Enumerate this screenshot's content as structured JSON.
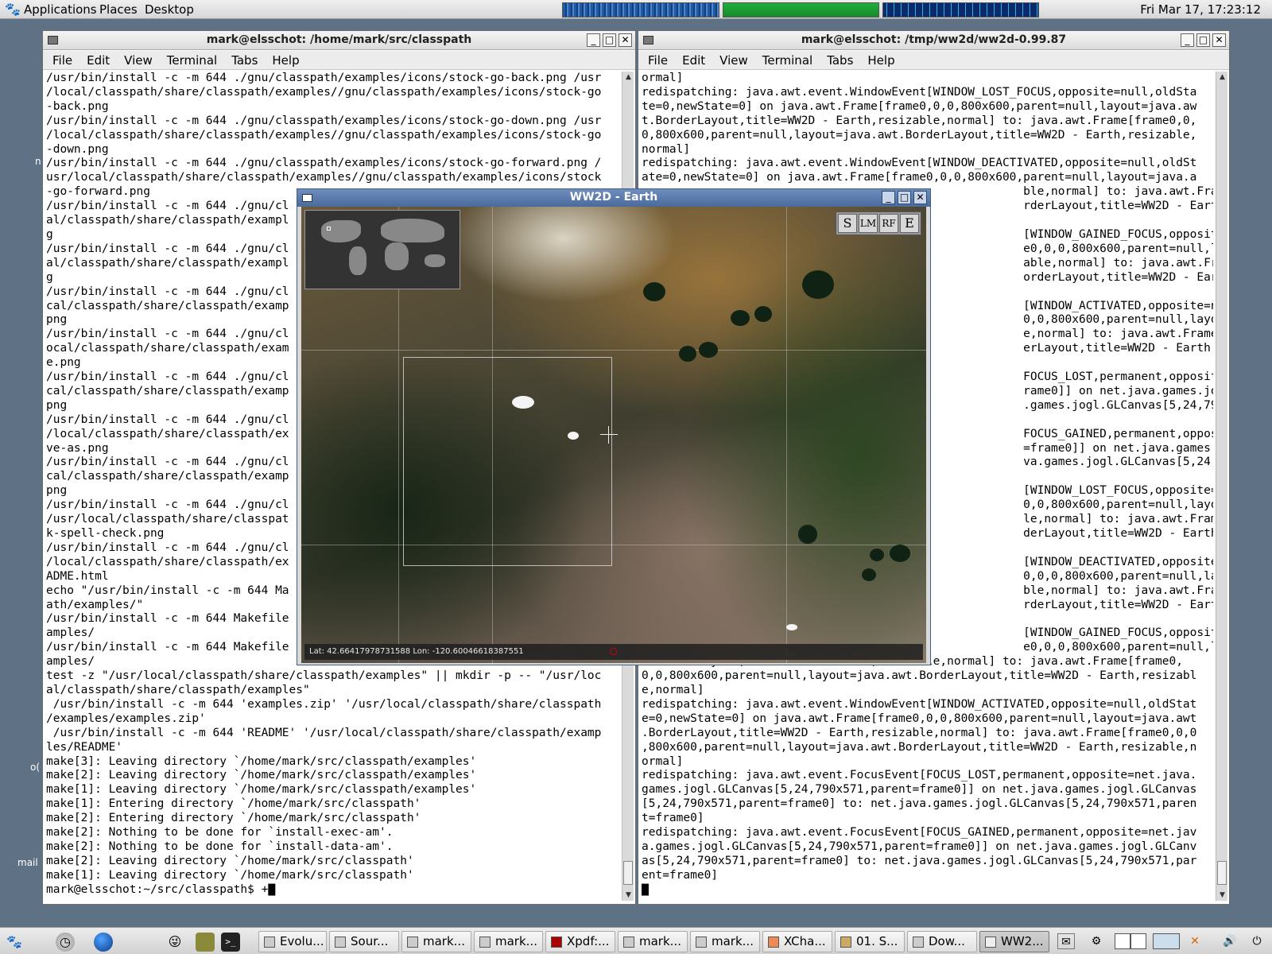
{
  "top_panel": {
    "menus": [
      "Applications",
      "Places",
      "Desktop"
    ],
    "clock": "Fri Mar 17, 17:23:12"
  },
  "desktop": {
    "labels": [
      "n",
      "o(",
      "mail"
    ]
  },
  "terminal_left": {
    "title": "mark@elsschot: /home/mark/src/classpath",
    "menu": [
      "File",
      "Edit",
      "View",
      "Terminal",
      "Tabs",
      "Help"
    ],
    "lines": [
      "/usr/bin/install -c -m 644 ./gnu/classpath/examples/icons/stock-go-back.png /usr",
      "/local/classpath/share/classpath/examples//gnu/classpath/examples/icons/stock-go",
      "-back.png",
      "/usr/bin/install -c -m 644 ./gnu/classpath/examples/icons/stock-go-down.png /usr",
      "/local/classpath/share/classpath/examples//gnu/classpath/examples/icons/stock-go",
      "-down.png",
      "/usr/bin/install -c -m 644 ./gnu/classpath/examples/icons/stock-go-forward.png /",
      "usr/local/classpath/share/classpath/examples//gnu/classpath/examples/icons/stock",
      "-go-forward.png",
      "/usr/bin/install -c -m 644 ./gnu/cl",
      "al/classpath/share/classpath/exampl",
      "g",
      "/usr/bin/install -c -m 644 ./gnu/cl",
      "al/classpath/share/classpath/exampl",
      "g",
      "/usr/bin/install -c -m 644 ./gnu/cl",
      "cal/classpath/share/classpath/examp",
      "png",
      "/usr/bin/install -c -m 644 ./gnu/cl",
      "ocal/classpath/share/classpath/exam",
      "e.png",
      "/usr/bin/install -c -m 644 ./gnu/cl",
      "cal/classpath/share/classpath/examp",
      "png",
      "/usr/bin/install -c -m 644 ./gnu/cl",
      "/local/classpath/share/classpath/ex",
      "ve-as.png",
      "/usr/bin/install -c -m 644 ./gnu/cl",
      "cal/classpath/share/classpath/examp",
      "png",
      "/usr/bin/install -c -m 644 ./gnu/cl",
      "/usr/local/classpath/share/classpat",
      "k-spell-check.png",
      "/usr/bin/install -c -m 644 ./gnu/cl",
      "/local/classpath/share/classpath/ex",
      "ADME.html",
      "echo \"/usr/bin/install -c -m 644 Ma",
      "ath/examples/\"",
      "/usr/bin/install -c -m 644 Makefile",
      "amples/",
      "/usr/bin/install -c -m 644 Makefile",
      "amples/",
      "test -z \"/usr/local/classpath/share/classpath/examples\" || mkdir -p -- \"/usr/loc",
      "al/classpath/share/classpath/examples\"",
      " /usr/bin/install -c -m 644 'examples.zip' '/usr/local/classpath/share/classpath",
      "/examples/examples.zip'",
      " /usr/bin/install -c -m 644 'README' '/usr/local/classpath/share/classpath/examp",
      "les/README'",
      "make[3]: Leaving directory `/home/mark/src/classpath/examples'",
      "make[2]: Leaving directory `/home/mark/src/classpath/examples'",
      "make[1]: Leaving directory `/home/mark/src/classpath/examples'",
      "make[1]: Entering directory `/home/mark/src/classpath'",
      "make[2]: Entering directory `/home/mark/src/classpath'",
      "make[2]: Nothing to be done for `install-exec-am'.",
      "make[2]: Nothing to be done for `install-data-am'.",
      "make[2]: Leaving directory `/home/mark/src/classpath'",
      "make[1]: Leaving directory `/home/mark/src/classpath'",
      "mark@elsschot:~/src/classpath$ +▇"
    ]
  },
  "terminal_right": {
    "title": "mark@elsschot: /tmp/ww2d/ww2d-0.99.87",
    "menu": [
      "File",
      "Edit",
      "View",
      "Terminal",
      "Tabs",
      "Help"
    ],
    "lines": [
      "ormal]",
      "redispatching: java.awt.event.WindowEvent[WINDOW_LOST_FOCUS,opposite=null,oldSta",
      "te=0,newState=0] on java.awt.Frame[frame0,0,0,800x600,parent=null,layout=java.aw",
      "t.BorderLayout,title=WW2D - Earth,resizable,normal] to: java.awt.Frame[frame0,0,",
      "0,800x600,parent=null,layout=java.awt.BorderLayout,title=WW2D - Earth,resizable,",
      "normal]",
      "redispatching: java.awt.event.WindowEvent[WINDOW_DEACTIVATED,opposite=null,oldSt",
      "ate=0,newState=0] on java.awt.Frame[frame0,0,0,800x600,parent=null,layout=java.a",
      "                                                       ble,normal] to: java.awt.Frame[frame0,0",
      "                                                       rderLayout,title=WW2D - Earth,resizable",
      "",
      "                                                       [WINDOW_GAINED_FOCUS,opposite=null,oldS",
      "                                                       e0,0,0,800x600,parent=null,layout=java.",
      "                                                       able,normal] to: java.awt.Frame[frame0,",
      "                                                       orderLayout,title=WW2D - Earth,resizabl",
      "",
      "                                                       [WINDOW_ACTIVATED,opposite=null,oldStat",
      "                                                       0,0,800x600,parent=null,layout=java.awt",
      "                                                       e,normal] to: java.awt.Frame[frame0,0,0",
      "                                                       erLayout,title=WW2D - Earth,resizable,n",
      "",
      "                                                       FOCUS_LOST,permanent,opposite=net.java.",
      "                                                       rame0]] on net.java.games.jogl.GLCanvas",
      "                                                       .games.jogl.GLCanvas[5,24,790x571,paren",
      "",
      "                                                       FOCUS_GAINED,permanent,opposite=net.jav",
      "                                                       =frame0]] on net.java.games.jogl.GLCanv",
      "                                                       va.games.jogl.GLCanvas[5,24,790x571,par",
      "",
      "                                                       [WINDOW_LOST_FOCUS,opposite=null,oldSta",
      "                                                       0,0,800x600,parent=null,layout=java.aw",
      "                                                       le,normal] to: java.awt.Frame[frame0,0,",
      "                                                       derLayout,title=WW2D - Earth,resizable,",
      "",
      "                                                       [WINDOW_DEACTIVATED,opposite=null,oldSt",
      "                                                       0,0,0,800x600,parent=null,layout=java.a",
      "                                                       ble,normal] to: java.awt.Frame[frame0,0",
      "                                                       rderLayout,title=WW2D - Earth,resizable",
      "",
      "                                                       [WINDOW_GAINED_FOCUS,opposite=null,oldS",
      "                                                       e0,0,0,800x600,parent=null,layout=java.",
      "t.BorderLayout,title=WW2D - Earth,resizable,normal] to: java.awt.Frame[frame0,",
      "0,0,800x600,parent=null,layout=java.awt.BorderLayout,title=WW2D - Earth,resizabl",
      "e,normal]",
      "redispatching: java.awt.event.WindowEvent[WINDOW_ACTIVATED,opposite=null,oldStat",
      "e=0,newState=0] on java.awt.Frame[frame0,0,0,800x600,parent=null,layout=java.awt",
      ".BorderLayout,title=WW2D - Earth,resizable,normal] to: java.awt.Frame[frame0,0,0",
      ",800x600,parent=null,layout=java.awt.BorderLayout,title=WW2D - Earth,resizable,n",
      "ormal]",
      "redispatching: java.awt.event.FocusEvent[FOCUS_LOST,permanent,opposite=net.java.",
      "games.jogl.GLCanvas[5,24,790x571,parent=frame0]] on net.java.games.jogl.GLCanvas",
      "[5,24,790x571,parent=frame0] to: net.java.games.jogl.GLCanvas[5,24,790x571,paren",
      "t=frame0]",
      "redispatching: java.awt.event.FocusEvent[FOCUS_GAINED,permanent,opposite=net.jav",
      "a.games.jogl.GLCanvas[5,24,790x571,parent=frame0]] on net.java.games.jogl.GLCanv",
      "as[5,24,790x571,parent=frame0] to: net.java.games.jogl.GLCanvas[5,24,790x571,par",
      "ent=frame0]",
      "▇"
    ]
  },
  "ww2d": {
    "title": "WW2D - Earth",
    "layer_buttons": [
      "S",
      "LM",
      "RF",
      "E"
    ],
    "status": "Lat: 42.66417978731588   Lon: -120.60046618387551"
  },
  "taskbar": {
    "tasks": [
      "Evolu...",
      "Sour...",
      "mark...",
      "mark...",
      "Xpdf:...",
      "mark...",
      "mark...",
      "XCha...",
      "01. S...",
      "Dow...",
      "WW2..."
    ]
  },
  "colors": {
    "ww2d_title": "#5a7aac",
    "cpu_graph": "#1e5aa8",
    "mem_graph": "#1fae3a",
    "net_graph": "#0b2a6b"
  }
}
